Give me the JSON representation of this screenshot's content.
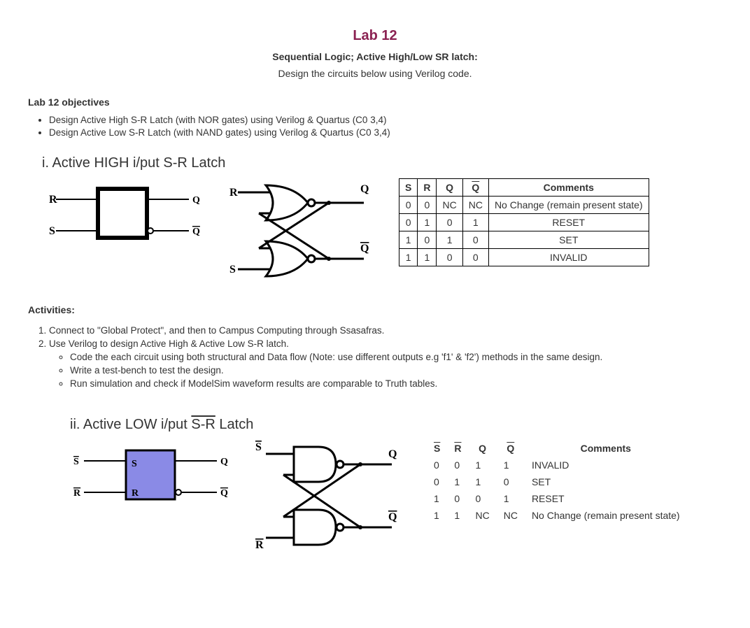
{
  "title": "Lab 12",
  "subtitle": "Sequential Logic;  Active High/Low SR latch:",
  "intro": "Design the circuits below using Verilog code.",
  "objectives_heading": "Lab 12 objectives",
  "objectives": [
    "Design Active High S-R Latch (with NOR gates) using Verilog & Quartus (C0 3,4)",
    "Design Active Low S-R Latch (with NAND gates) using Verilog & Quartus (C0 3,4)"
  ],
  "section1_title": "i. Active HIGH i/put S-R Latch",
  "section2_title_prefix": "ii. Active LOW i/put ",
  "section2_title_sr": "S-R",
  "section2_title_suffix": " Latch",
  "table1": {
    "headers": [
      "S",
      "R",
      "Q",
      "Q̄",
      "Comments"
    ],
    "rows": [
      [
        "0",
        "0",
        "NC",
        "NC",
        "No Change (remain present state)"
      ],
      [
        "0",
        "1",
        "0",
        "1",
        "RESET"
      ],
      [
        "1",
        "0",
        "1",
        "0",
        "SET"
      ],
      [
        "1",
        "1",
        "0",
        "0",
        "INVALID"
      ]
    ]
  },
  "table2": {
    "headers": [
      "S̄",
      "R̄",
      "Q",
      "Q̄",
      "Comments"
    ],
    "rows": [
      [
        "0",
        "0",
        "1",
        "1",
        "INVALID"
      ],
      [
        "0",
        "1",
        "1",
        "0",
        "SET"
      ],
      [
        "1",
        "0",
        "0",
        "1",
        "RESET"
      ],
      [
        "1",
        "1",
        "NC",
        "NC",
        "No Change (remain present state)"
      ]
    ]
  },
  "activities_heading": "Activities:",
  "activities": [
    "Connect to \"Global Protect\", and then to Campus Computing through Ssasafras.",
    "Use Verilog to design Active High & Active Low S-R latch."
  ],
  "sublist": [
    "Code the each circuit using both structural and Data flow (Note: use different outputs e.g 'f1' & 'f2') methods in the same design.",
    "Write a test-bench to test the design.",
    "Run simulation and check if ModelSim waveform results are comparable to Truth tables."
  ],
  "labels": {
    "R": "R",
    "S": "S",
    "Q": "Q",
    "Qbar": "Q"
  }
}
